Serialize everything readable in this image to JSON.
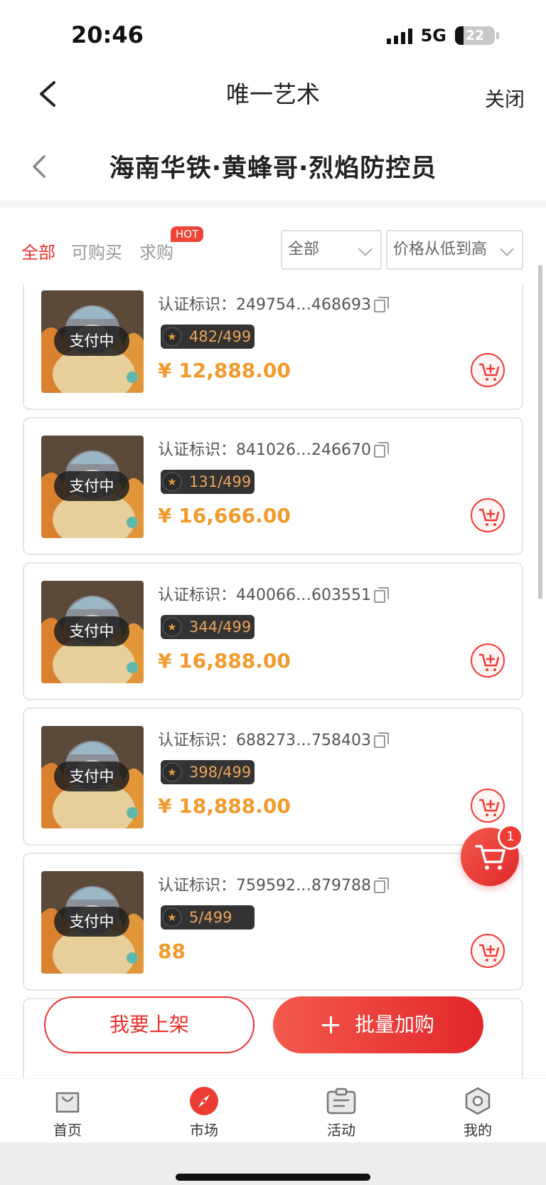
{
  "status_bar": {
    "time": "20:46",
    "network": "5G",
    "battery": "22",
    "battery_level": 0.22
  },
  "nav": {
    "title": "唯一艺术",
    "close_label": "关闭"
  },
  "page": {
    "title": "海南华铁·黄蜂哥·烈焰防控员"
  },
  "filters": {
    "tabs": [
      {
        "label": "全部",
        "active": true
      },
      {
        "label": "可购买",
        "active": false
      },
      {
        "label": "求购",
        "active": false
      }
    ],
    "hot_badge": "HOT",
    "select_all": "全部",
    "select_sort": "价格从低到高"
  },
  "items": [
    {
      "status": "支付中",
      "cert_label": "认证标识：",
      "cert_id": "249754…468693",
      "edition": "482/499",
      "price": "¥ 12,888.00"
    },
    {
      "status": "支付中",
      "cert_label": "认证标识：",
      "cert_id": "841026…246670",
      "edition": "131/499",
      "price": "¥ 16,666.00"
    },
    {
      "status": "支付中",
      "cert_label": "认证标识：",
      "cert_id": "440066…603551",
      "edition": "344/499",
      "price": "¥ 16,888.00"
    },
    {
      "status": "支付中",
      "cert_label": "认证标识：",
      "cert_id": "688273…758403",
      "edition": "398/499",
      "price": "¥ 18,888.00"
    },
    {
      "status": "支付中",
      "cert_label": "认证标识：",
      "cert_id": "759592…879788",
      "edition": "5/499",
      "price": "88"
    }
  ],
  "cart": {
    "count": "1"
  },
  "actions": {
    "list_label": "我要上架",
    "batch_label": "批量加购"
  },
  "tab_bar": [
    {
      "label": "首页",
      "icon": "bag-icon"
    },
    {
      "label": "市场",
      "icon": "compass-icon",
      "active": true
    },
    {
      "label": "活动",
      "icon": "clipboard-icon"
    },
    {
      "label": "我的",
      "icon": "hexagon-icon"
    }
  ],
  "colors": {
    "accent": "#e8302c",
    "price": "#f29b2c",
    "edition_text": "#e9a45a"
  }
}
